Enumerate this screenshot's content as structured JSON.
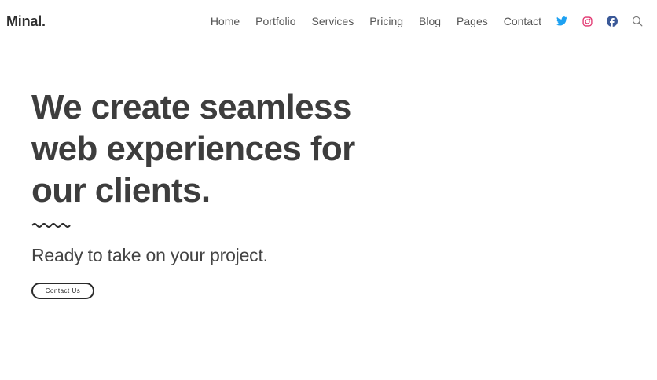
{
  "brand": {
    "name": "Minal."
  },
  "nav": {
    "items": [
      "Home",
      "Portfolio",
      "Services",
      "Pricing",
      "Blog",
      "Pages",
      "Contact"
    ]
  },
  "social": {
    "icons": [
      "twitter-icon",
      "instagram-icon",
      "facebook-icon",
      "search-icon"
    ],
    "colors": {
      "twitter": "#1da1f2",
      "instagram": "#e1306c",
      "facebook": "#3b5998",
      "search": "#777777"
    }
  },
  "hero": {
    "title_line1": "We create seamless",
    "title_line2": "web experiences for",
    "title_line3": "our clients.",
    "subtitle": "Ready to take on your project.",
    "cta_label": "Contact Us"
  }
}
